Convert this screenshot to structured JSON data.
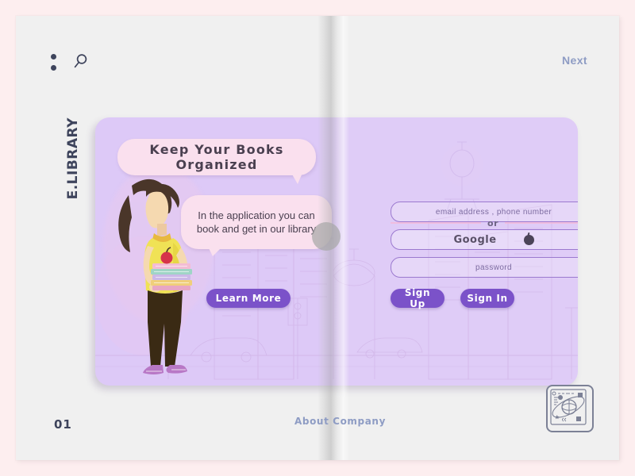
{
  "topbar": {
    "menu_icon": "menu-dots-icon",
    "search_icon": "search-icon",
    "next_label": "Next"
  },
  "brand": {
    "name": "E.LIBRARY"
  },
  "left_page": {
    "headline": "Keep Your Books Organized",
    "body": "In the application you can book and get in our library",
    "cta_label": "Learn More",
    "illustration": "woman-carrying-books-illustration"
  },
  "right_page": {
    "email_placeholder": "email address , phone number",
    "password_placeholder": "password",
    "divider_label": "or",
    "google_label": "Google",
    "google_icon": "google-mark-icon",
    "sign_up_label": "Sign Up",
    "sign_in_label": "Sign In",
    "illustration": "street-lamp-city-linework"
  },
  "footer": {
    "page_number": "01",
    "about_label": "About Company",
    "badge_icon": "globe-network-badge-icon"
  },
  "colors": {
    "page_background": "#fdeeef",
    "paper": "#f0f0f0",
    "card_purple": "#ddc9f7",
    "bubble_pink": "#fae0ee",
    "accent_purple": "#7b52c9",
    "link_blue": "#8e9cc4",
    "ink": "#3e445c"
  }
}
